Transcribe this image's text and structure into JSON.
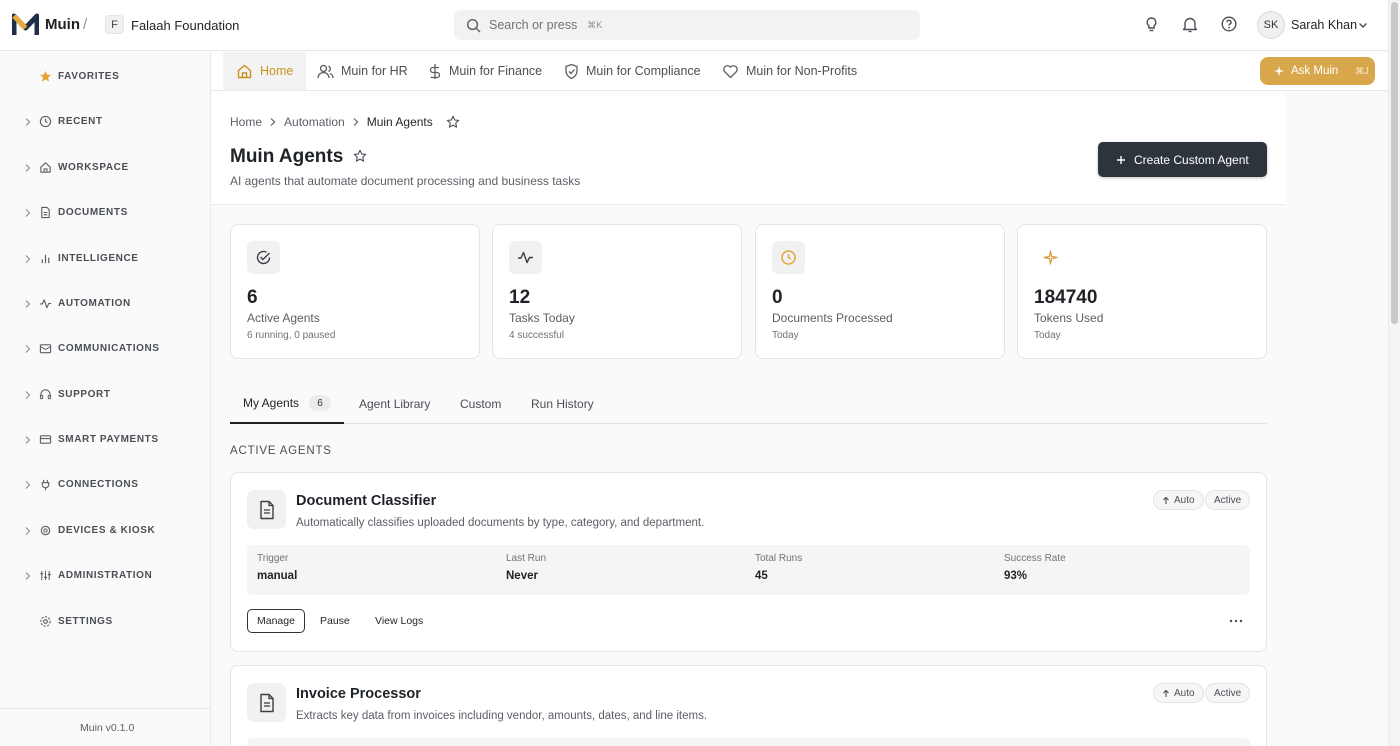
{
  "org": {
    "initial": "F",
    "name": "Falaah Foundation"
  },
  "app": {
    "name": "Muin",
    "version": "Muin v0.1.0"
  },
  "search": {
    "placeholder": "Search or press",
    "shortcut": "⌘K"
  },
  "user": {
    "initials": "SK",
    "name": "Sarah Khan"
  },
  "sidebar": {
    "items": [
      {
        "label": "FAVORITES",
        "icon": "star-icon"
      },
      {
        "label": "RECENT",
        "icon": "clock-icon"
      },
      {
        "label": "WORKSPACE",
        "icon": "home-icon"
      },
      {
        "label": "DOCUMENTS",
        "icon": "document-icon"
      },
      {
        "label": "INTELLIGENCE",
        "icon": "bar-chart-icon"
      },
      {
        "label": "AUTOMATION",
        "icon": "activity-icon"
      },
      {
        "label": "COMMUNICATIONS",
        "icon": "mail-icon"
      },
      {
        "label": "SUPPORT",
        "icon": "headset-icon"
      },
      {
        "label": "SMART PAYMENTS",
        "icon": "credit-card-icon"
      },
      {
        "label": "CONNECTIONS",
        "icon": "plug-icon"
      },
      {
        "label": "DEVICES & KIOSK",
        "icon": "cpu-icon"
      },
      {
        "label": "ADMINISTRATION",
        "icon": "sliders-icon"
      },
      {
        "label": "SETTINGS",
        "icon": "gear-icon"
      }
    ]
  },
  "nav": {
    "tabs": [
      {
        "label": "Home"
      },
      {
        "label": "Muin for HR"
      },
      {
        "label": "Muin for Finance"
      },
      {
        "label": "Muin for Compliance"
      },
      {
        "label": "Muin for Non-Profits"
      }
    ],
    "ask_label": "Ask Muin",
    "ask_shortcut": "⌘J"
  },
  "breadcrumb": [
    "Home",
    "Automation",
    "Muin Agents"
  ],
  "page": {
    "title": "Muin Agents",
    "subtitle": "AI agents that automate document processing and business tasks",
    "create_label": "Create Custom Agent"
  },
  "stats": [
    {
      "value": "6",
      "label": "Active Agents",
      "sub": "6 running, 0 paused",
      "icon": "check-circle-icon"
    },
    {
      "value": "12",
      "label": "Tasks Today",
      "sub": "4 successful",
      "icon": "activity-icon"
    },
    {
      "value": "0",
      "label": "Documents Processed",
      "sub": "Today",
      "icon": "clock-icon"
    },
    {
      "value": "184740",
      "label": "Tokens Used",
      "sub": "Today",
      "icon": "sparkle-icon"
    }
  ],
  "tabs": [
    {
      "label": "My Agents",
      "count": "6"
    },
    {
      "label": "Agent Library"
    },
    {
      "label": "Custom"
    },
    {
      "label": "Run History"
    }
  ],
  "section_label": "ACTIVE AGENTS",
  "agents": [
    {
      "name": "Document Classifier",
      "description": "Automatically classifies uploaded documents by type, category, and department.",
      "mode": "Auto",
      "status": "Active",
      "metrics": [
        {
          "label": "Trigger",
          "value": "manual"
        },
        {
          "label": "Last Run",
          "value": "Never"
        },
        {
          "label": "Total Runs",
          "value": "45"
        },
        {
          "label": "Success Rate",
          "value": "93%"
        }
      ],
      "actions": [
        "Manage",
        "Pause",
        "View Logs"
      ]
    },
    {
      "name": "Invoice Processor",
      "description": "Extracts key data from invoices including vendor, amounts, dates, and line items.",
      "mode": "Auto",
      "status": "Active"
    }
  ],
  "colors": {
    "accent": "#d8a74b",
    "active_tab_text": "#c8921e",
    "dark_button": "#2e343b"
  }
}
